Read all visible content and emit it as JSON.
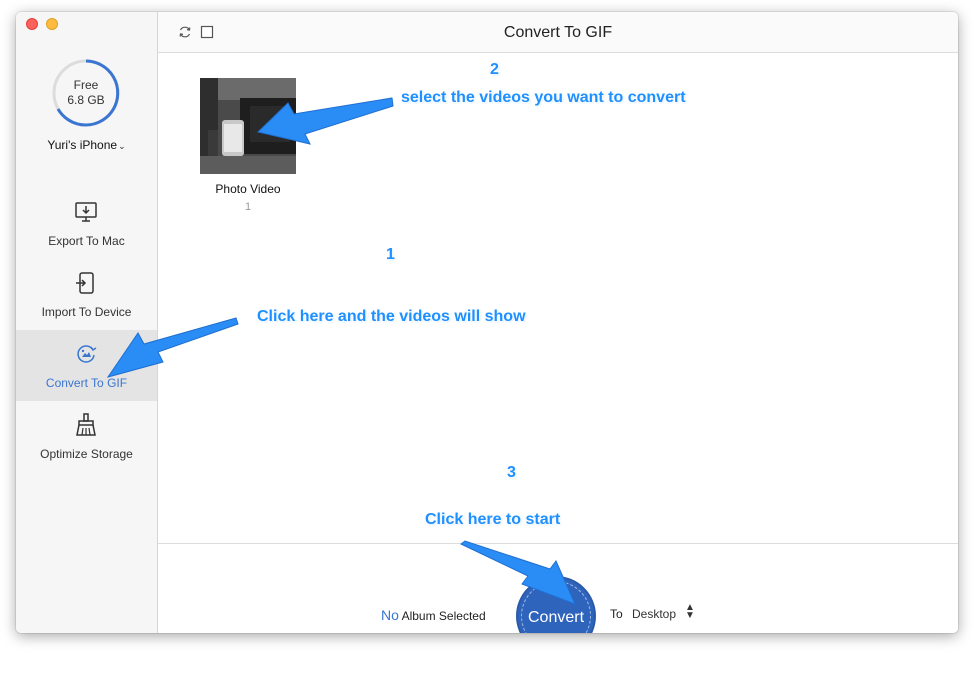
{
  "sidebar": {
    "storage": {
      "line1": "Free",
      "line2": "6.8 GB"
    },
    "device_name": "Yuri's iPhone",
    "items": [
      {
        "label": "Export To Mac",
        "icon": "export-to-mac-icon"
      },
      {
        "label": "Import To Device",
        "icon": "import-to-device-icon"
      },
      {
        "label": "Convert To GIF",
        "icon": "convert-to-gif-icon"
      },
      {
        "label": "Optimize Storage",
        "icon": "optimize-storage-icon"
      }
    ]
  },
  "header": {
    "title": "Convert To GIF"
  },
  "album": {
    "name": "Photo Video",
    "count": "1"
  },
  "footer": {
    "no": "No",
    "album_selected": "Album Selected",
    "convert_label": "Convert",
    "to_label": "To",
    "destination": "Desktop"
  },
  "annotations": {
    "step1_num": "1",
    "step1_text": "Click here and the videos will show",
    "step2_num": "2",
    "step2_text": "select the videos you want to  convert",
    "step3_num": "3",
    "step3_text": "Click here to start"
  },
  "colors": {
    "accent": "#3a76d1",
    "annotation": "#1e90ff",
    "convert_button": "#2f64bd"
  }
}
